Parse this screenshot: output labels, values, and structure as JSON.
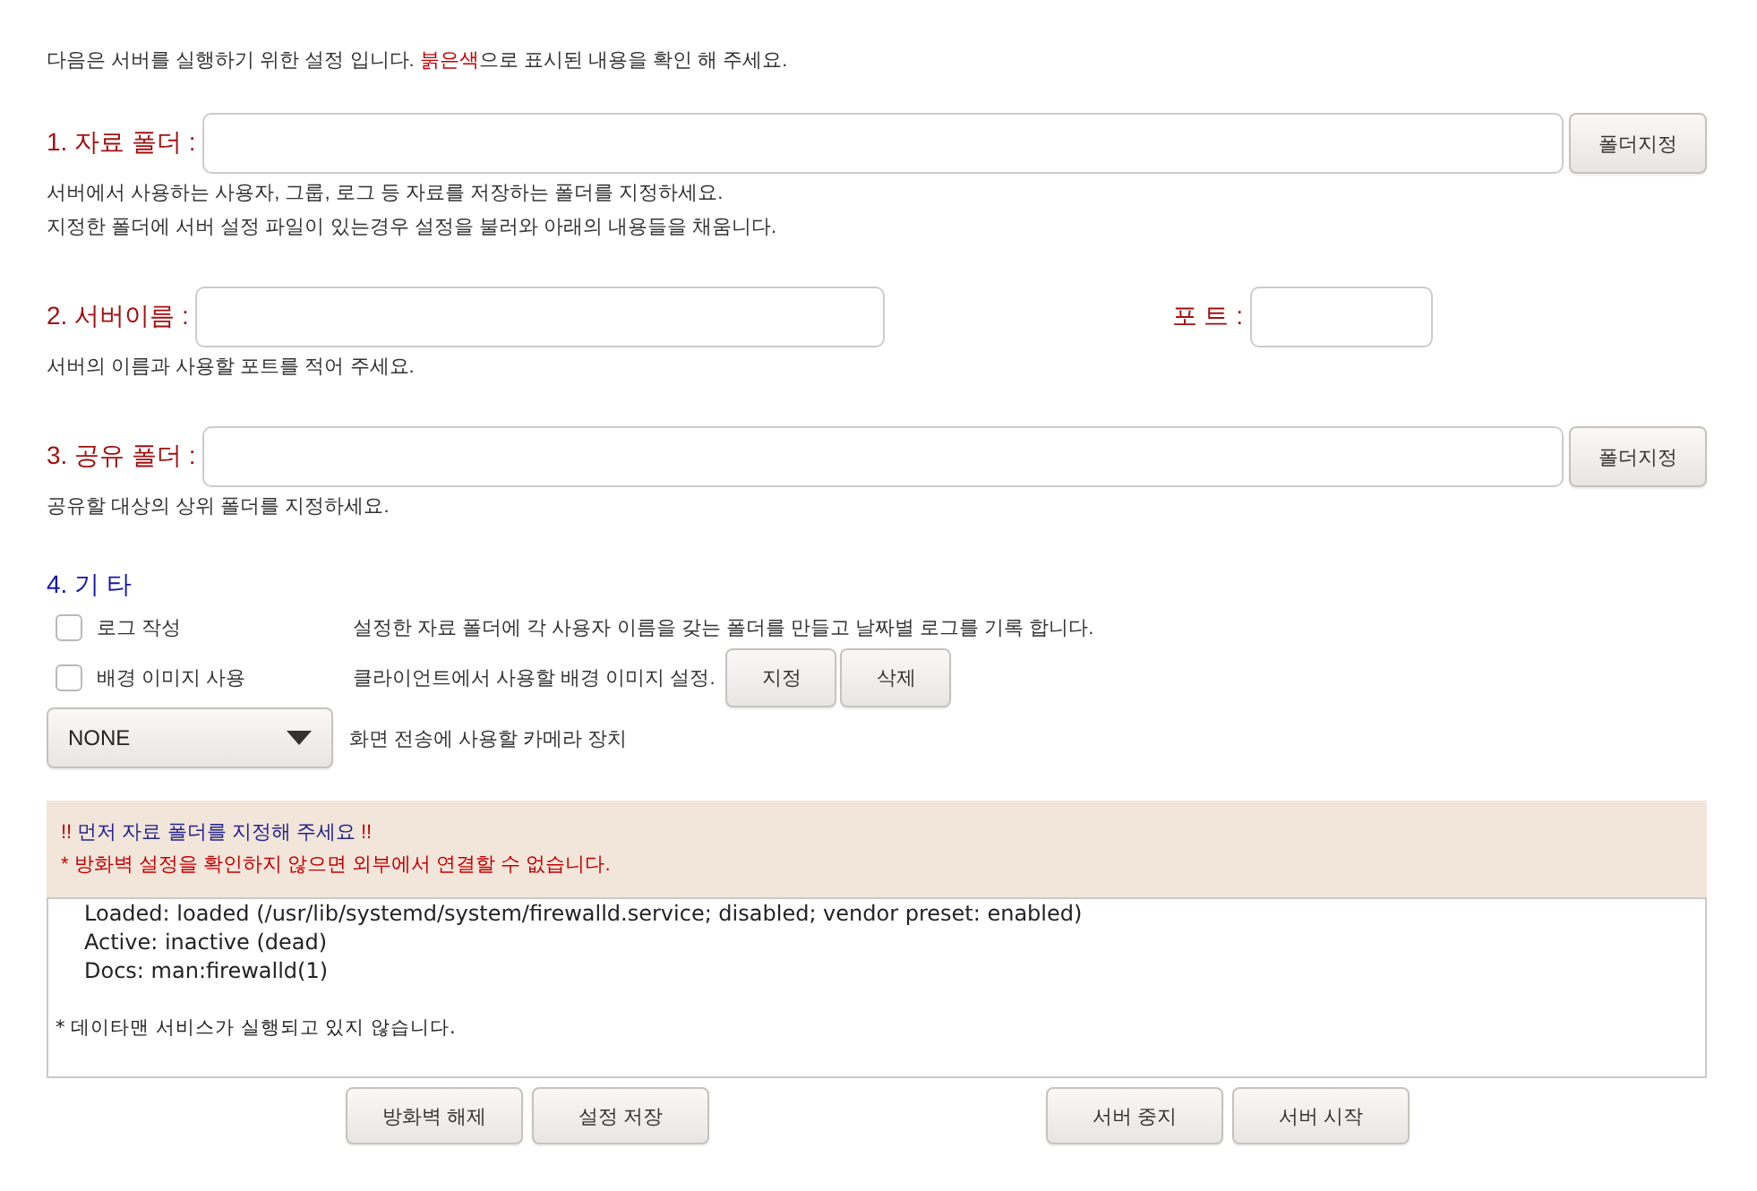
{
  "intro": {
    "parts": [
      {
        "text": "다음은 서버를 실행하기 위한 설정 입니다. ",
        "highlight": false
      },
      {
        "text": "붉은색",
        "highlight": true
      },
      {
        "text": "으로 표시된 내용을 확인 해 주세요.",
        "highlight": false
      }
    ]
  },
  "sections": [
    {
      "kind": "folder",
      "label": "1. 자료 폴더 :",
      "button": "폴더지정",
      "help": [
        "서버에서 사용하는 사용자, 그룹, 로그 등 자료를 저장하는 폴더를 지정하세요.",
        "지정한 폴더에 서버 설정 파일이 있는경우 설정을 불러와 아래의 내용들을 채움니다."
      ]
    },
    {
      "kind": "server",
      "label": "2. 서버이름 :",
      "port_label": "포 트 :",
      "help": [
        "서버의 이름과 사용할 포트를 적어 주세요."
      ]
    },
    {
      "kind": "folder",
      "label": "3. 공유 폴더 :",
      "button": "폴더지정",
      "help": [
        "공유할 대상의 상위 폴더를 지정하세요."
      ]
    }
  ],
  "etc": {
    "heading": "4. 기 타",
    "options": [
      {
        "label": "로그 작성",
        "checked": false,
        "description": "설정한 자료 폴더에 각 사용자 이름을 갖는 폴더를 만들고 날짜별 로그를 기록 합니다."
      },
      {
        "label": "배경 이미지 사용",
        "checked": false,
        "description": "클라이언트에서 사용할 배경 이미지 설정.",
        "buttons": [
          "지정",
          "삭제"
        ]
      }
    ]
  },
  "camera": {
    "value": "NONE",
    "description": "화면 전송에 사용할 카메라 장치"
  },
  "notice": {
    "lines": [
      {
        "parts": [
          {
            "text": "!!",
            "highlight": true
          },
          {
            "text": " 먼저 자료 폴더를 지정해 주세요 ",
            "highlight": false
          },
          {
            "text": "!!",
            "highlight": true
          }
        ]
      },
      {
        "parts": [
          {
            "text": "* 방화벽 설정을 확인하지 않으면 외부에서 연결할 수 없습니다.",
            "highlight": true
          }
        ]
      }
    ]
  },
  "log": {
    "lines": [
      {
        "kind": "status",
        "text": "Loaded: loaded (/usr/lib/systemd/system/firewalld.service; disabled; vendor preset: enabled)"
      },
      {
        "kind": "status",
        "text": "Active: inactive (dead)"
      },
      {
        "kind": "status",
        "text": "Docs: man:firewalld(1)"
      },
      {
        "kind": "message",
        "text": "* 데이타맨 서비스가 실행되고 있지 않습니다."
      }
    ]
  },
  "action_groups": [
    [
      "방화벽 해제",
      "설정 저장"
    ],
    [
      "서버 중지",
      "서버 시작"
    ]
  ]
}
